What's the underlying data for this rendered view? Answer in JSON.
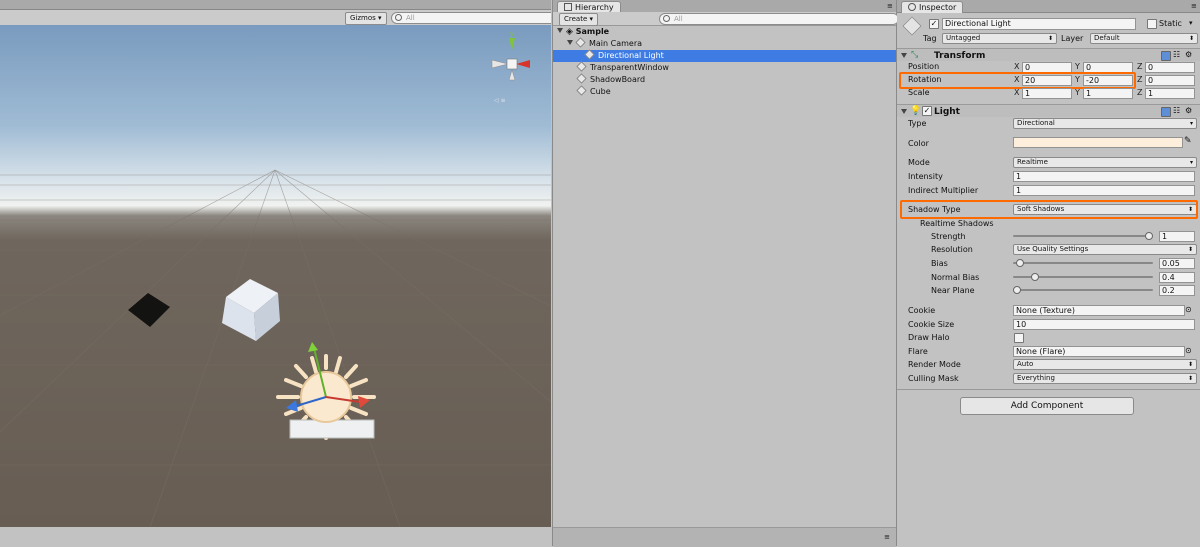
{
  "scene": {
    "gizmos_label": "Gizmos",
    "search_placeholder": "All",
    "axis_labels": {
      "y": "y",
      "x": "x"
    }
  },
  "hierarchy": {
    "tab_label": "Hierarchy",
    "create_label": "Create",
    "search_placeholder": "All",
    "scene_name": "Sample",
    "items": [
      {
        "label": "Main Camera"
      },
      {
        "label": "Directional Light",
        "selected": true
      },
      {
        "label": "TransparentWindow"
      },
      {
        "label": "ShadowBoard"
      },
      {
        "label": "Cube"
      }
    ]
  },
  "inspector": {
    "tab_label": "Inspector",
    "object_name": "Directional Light",
    "static_label": "Static",
    "tag_label": "Tag",
    "tag_value": "Untagged",
    "layer_label": "Layer",
    "layer_value": "Default",
    "transform": {
      "title": "Transform",
      "rows": [
        {
          "label": "Position",
          "x": "0",
          "y": "0",
          "z": "0"
        },
        {
          "label": "Rotation",
          "x": "20",
          "y": "-20",
          "z": "0"
        },
        {
          "label": "Scale",
          "x": "1",
          "y": "1",
          "z": "1"
        }
      ],
      "axis_x": "X",
      "axis_y": "Y",
      "axis_z": "Z"
    },
    "light": {
      "title": "Light",
      "type_label": "Type",
      "type_value": "Directional",
      "color_label": "Color",
      "color_value": "#fdefdc",
      "mode_label": "Mode",
      "mode_value": "Realtime",
      "intensity_label": "Intensity",
      "intensity_value": "1",
      "indirect_label": "Indirect Multiplier",
      "indirect_value": "1",
      "shadow_type_label": "Shadow Type",
      "shadow_type_value": "Soft Shadows",
      "realtime_shadows_label": "Realtime Shadows",
      "strength_label": "Strength",
      "strength_value": "1",
      "strength_fraction": 1.0,
      "resolution_label": "Resolution",
      "resolution_value": "Use Quality Settings",
      "bias_label": "Bias",
      "bias_value": "0.05",
      "bias_fraction": 0.025,
      "normal_bias_label": "Normal Bias",
      "normal_bias_value": "0.4",
      "normal_bias_fraction": 0.133,
      "near_plane_label": "Near Plane",
      "near_plane_value": "0.2",
      "near_plane_fraction": 0.0,
      "cookie_label": "Cookie",
      "cookie_value": "None (Texture)",
      "cookie_size_label": "Cookie Size",
      "cookie_size_value": "10",
      "draw_halo_label": "Draw Halo",
      "flare_label": "Flare",
      "flare_value": "None (Flare)",
      "render_mode_label": "Render Mode",
      "render_mode_value": "Auto",
      "culling_mask_label": "Culling Mask",
      "culling_mask_value": "Everything"
    },
    "add_component_label": "Add Component"
  },
  "colors": {
    "highlight": "#ff6a00",
    "selection": "#3e7ce4",
    "light_color": "#fdefdc"
  }
}
